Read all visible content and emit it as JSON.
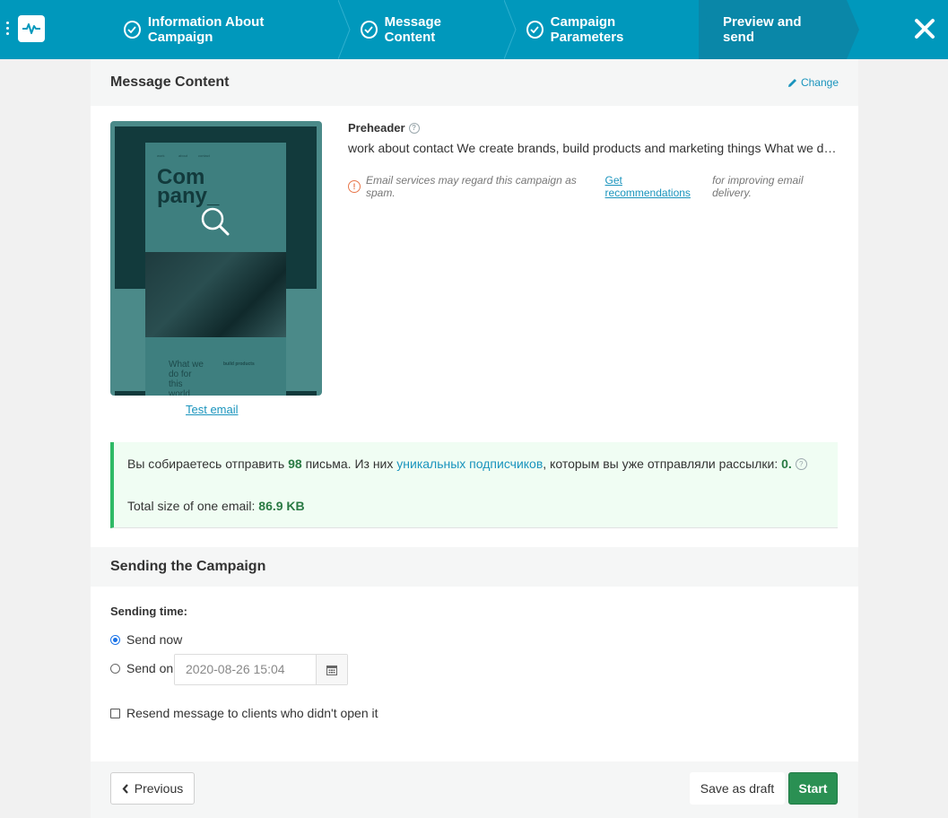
{
  "topbar": {
    "steps": [
      {
        "label": "Information About Campaign",
        "done": true
      },
      {
        "label": "Message Content",
        "done": true
      },
      {
        "label": "Campaign Parameters",
        "done": true
      },
      {
        "label": "Preview and send",
        "done": false,
        "active": true
      }
    ],
    "close_icon": "close-icon",
    "logo_icon": "pulse-icon",
    "menu_icon": "vertical-dots-icon"
  },
  "message_content": {
    "title": "Message Content",
    "change_label": "Change",
    "test_email_label": "Test email",
    "preview": {
      "title_line1": "Com",
      "title_line2": "pany_",
      "nav": [
        "work",
        "about",
        "contact"
      ],
      "lower_title": [
        "What we",
        "do for",
        "this",
        "world"
      ],
      "lower_subtitle": "build products"
    },
    "preheader_label": "Preheader",
    "preheader_text": "work about contact We create brands, build products and marketing things What we do for this world",
    "spam_warning_prefix": "Email services may regard this campaign as spam.",
    "spam_warning_link": "Get recommendations",
    "spam_warning_suffix": "for improving email delivery."
  },
  "summary": {
    "line1_a": "Вы собираетесь отправить",
    "count": "98",
    "line1_b": "письма.  Из них",
    "unique_link": "уникальных подписчиков",
    "line1_c": ", которым вы уже отправляли рассылки:",
    "already_sent": "0.",
    "size_label": "Total size of one email:",
    "size_value": "86.9 KB"
  },
  "sending": {
    "title": "Sending the Campaign",
    "time_label": "Sending time:",
    "send_now_label": "Send now",
    "send_on_label": "Send on",
    "send_on_value": "2020-08-26 15:04",
    "selected": "send_now",
    "resend_label": "Resend message to clients who didn't open it",
    "resend_checked": false
  },
  "footer": {
    "previous_label": "Previous",
    "draft_label": "Save as draft",
    "start_label": "Start"
  },
  "colors": {
    "topbar": "#0098bc",
    "active_step": "#0a87a8",
    "link": "#1a94bd",
    "success": "#2fba66",
    "start_button": "#2a9053",
    "warning": "#e8774b"
  }
}
